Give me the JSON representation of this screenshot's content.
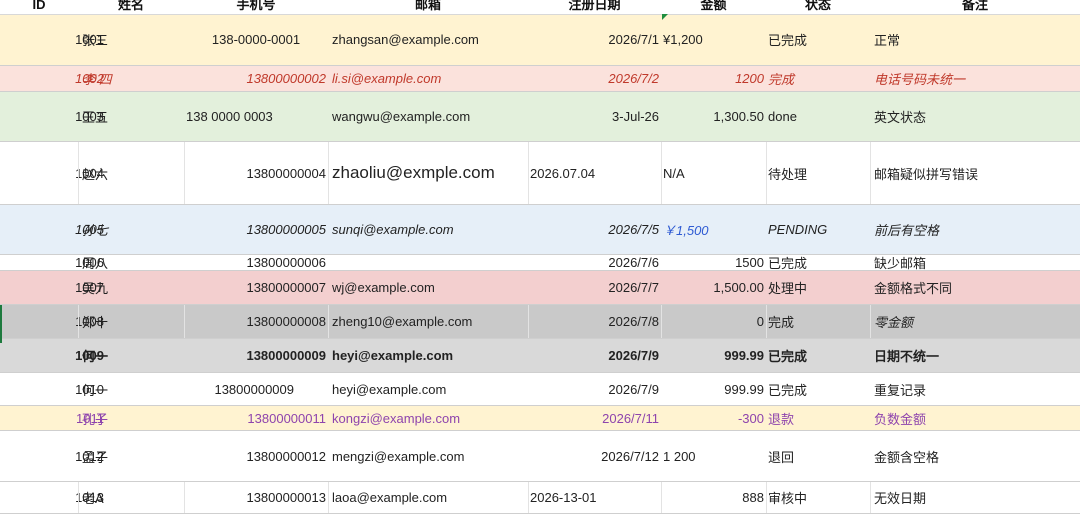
{
  "header": {
    "id": "ID",
    "name": "姓名",
    "phone": "手机号",
    "email": "邮箱",
    "date": "注册日期",
    "amount": "金额",
    "status": "状态",
    "note": "备注"
  },
  "rows": [
    {
      "id": "1001",
      "name": "张三",
      "phone": "138-0000-0001",
      "email": "zhangsan@example.com",
      "date": "2026/7/1",
      "amount": "¥1,200",
      "status": "已完成",
      "note": "正常"
    },
    {
      "id": "1002",
      "name": "李 四",
      "phone": "13800000002",
      "email": "li.si@example.com",
      "date": "2026/7/2",
      "amount": "1200",
      "status": "完成",
      "note": "电话号码未统一"
    },
    {
      "id": "1003",
      "name": "王五",
      "phone": "138 0000 0003",
      "email": "wangwu@example.com",
      "date": "3-Jul-26",
      "amount": "1,300.50",
      "status": "done",
      "note": "英文状态"
    },
    {
      "id": "1004",
      "name": "赵六",
      "phone": "13800000004",
      "email": "zhaoliu@exmple.com",
      "date": "2026.07.04",
      "amount": "N/A",
      "status": "待处理",
      "note": "邮箱疑似拼写错误"
    },
    {
      "id": "1005",
      "name": "孙七",
      "phone": "13800000005",
      "email": "sunqi@example.com",
      "date": "2026/7/5",
      "amount": "￥1,500",
      "status": "PENDING",
      "note": "前后有空格"
    },
    {
      "id": "1006",
      "name": "周八",
      "phone": "13800000006",
      "email": "",
      "date": "2026/7/6",
      "amount": "1500",
      "status": "已完成",
      "note": "缺少邮箱"
    },
    {
      "id": "1007",
      "name": "吴九",
      "phone": "13800000007",
      "email": "wj@example.com",
      "date": "2026/7/7",
      "amount": "1,500.00",
      "status": "处理中",
      "note": "金额格式不同"
    },
    {
      "id": "1008",
      "name": "郑十",
      "phone": "13800000008",
      "email": "zheng10@example.com",
      "date": "2026/7/8",
      "amount": "0",
      "status": "完成",
      "note": "零金额"
    },
    {
      "id": "1009",
      "name": "何一",
      "phone": "13800000009",
      "email": "heyi@example.com",
      "date": "2026/7/9",
      "amount": "999.99",
      "status": "已完成",
      "note": "日期不统一"
    },
    {
      "id": "1010",
      "name": "何一",
      "phone": "13800000009",
      "email": "heyi@example.com",
      "date": "2026/7/9",
      "amount": "999.99",
      "status": "已完成",
      "note": "重复记录"
    },
    {
      "id": "1011",
      "name": "孔子",
      "phone": "13800000011",
      "email": "kongzi@example.com",
      "date": "2026/7/11",
      "amount": "-300",
      "status": "退款",
      "note": "负数金额"
    },
    {
      "id": "1012",
      "name": "孟子",
      "phone": "13800000012",
      "email": "mengzi@example.com",
      "date": "2026/7/12",
      "amount": "1 200",
      "status": "退回",
      "note": "金额含空格"
    },
    {
      "id": "1013",
      "name": "老A",
      "phone": "13800000013",
      "email": "laoa@example.com",
      "date": "2026-13-01",
      "amount": "888",
      "status": "审核中",
      "note": "无效日期"
    }
  ],
  "colors": {
    "yellow": "#fff3d1",
    "pink": "#fbe2dc",
    "green": "#e3f0dc",
    "blue": "#e6eff8",
    "red": "#f3cfcf",
    "gray": "#c9c9c9",
    "light_gray": "#d9d9d9",
    "text_red": "#c0392b",
    "text_purple": "#8e44ad",
    "text_blue": "#2f5bd3"
  }
}
